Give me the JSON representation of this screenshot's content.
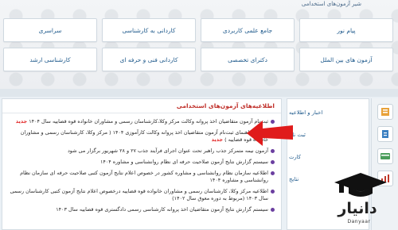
{
  "header": {
    "title": "شیر آزمون‌های استخدامی"
  },
  "tiles_row1": [
    {
      "label": "پیام نور"
    },
    {
      "label": "جامع علمی کاربردی"
    },
    {
      "label": "کاردانی به کارشناسی"
    },
    {
      "label": "سراسری"
    }
  ],
  "tiles_row2": [
    {
      "label": "آزمون های بین الملل"
    },
    {
      "label": "دکترای تخصصی"
    },
    {
      "label": "کاردانی فنی و حرفه ای"
    },
    {
      "label": "کارشناسی ارشد"
    }
  ],
  "news": {
    "title": "اطلاعیه‌های آزمون‌های استخدامی",
    "new_label": "جدید",
    "items": [
      {
        "text": "ثبت‌نام آزمون متقاضیان اخذ پروانه وکالت مرکز وکلا،کارشناسان رسمی و مشاوران خانواده قوه قضاییه سال ۱۴۰۴",
        "is_new": true
      },
      {
        "text": "دفترچه راهنمای ثبت‌نام آزمون متقاضیان اخذ پروانه وکالت کارآموزی ۱۴۰۴ ( مرکز وکلا، کارشناسان رسمی و مشاوران خانواده قوه قضاییه )",
        "is_new": true
      },
      {
        "text": "آزمون نیمه متمرکز جذب راهبر تحت عنوان اجرای فرآیند جذب ۲۷ و ۲۸ شهریور برگزار می شود",
        "is_new": false
      },
      {
        "text": "سیستم گزارش نتایج آزمون صلاحیت حرفه ای نظام روانشناسی و مشاوره ۱۴۰۴",
        "is_new": false
      },
      {
        "text": "اطلاعیه سازمان نظام روانشناسی و مشاوره کشور در خصوص اعلام نتایج آزمون کتبی صلاحیت حرفه ای سازمان نظام روانشناسی و مشاوره ۱۴۰۴",
        "is_new": false
      },
      {
        "text": "اطلاعیه مرکز وکلا، کارشناسان رسمی و مشاوران خانواده قوه قضاییه درخصوص اعلام نتایج آزمون کتبی کارشناسان رسمی سال ۱۴۰۳ (مربوط به دوره معوق سال ۱۴۰۲)",
        "is_new": false
      },
      {
        "text": "سیستم گزارش نتایج آزمون متقاضیان اخذ پروانه کارشناسی رسمی دادگستری قوه قضاییه سال ۱۴۰۳",
        "is_new": false
      }
    ]
  },
  "side": {
    "items": [
      {
        "label": "اخبار و اطلاعیه",
        "icon": "news-icon"
      },
      {
        "label": "ثبت نام",
        "icon": "register-icon"
      },
      {
        "label": "کارت",
        "icon": "card-icon"
      },
      {
        "label": "نتایج",
        "icon": "results-icon"
      }
    ]
  },
  "logo": {
    "name": "دانیار",
    "sub": "Danyaar"
  },
  "colors": {
    "arrow": "#e01b1b",
    "tile_text": "#1f5a8c",
    "news_title": "#c0302a",
    "bullet": "#6b3fa0"
  }
}
